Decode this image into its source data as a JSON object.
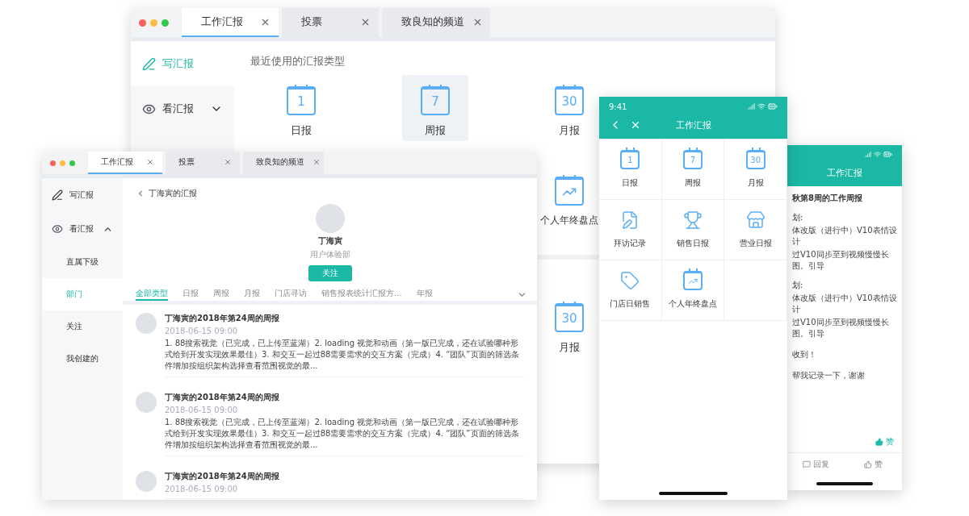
{
  "back_window": {
    "tabs": [
      {
        "label": "工作汇报",
        "selected": true
      },
      {
        "label": "投票",
        "selected": false
      },
      {
        "label": "致良知的频道",
        "selected": false
      }
    ],
    "sidebar": [
      {
        "kind": "write",
        "label": "写汇报",
        "selected": true
      },
      {
        "kind": "view",
        "label": "看汇报",
        "selected": false,
        "expanded": false
      }
    ],
    "heading": "最近使用的汇报类型",
    "recent": [
      {
        "kind": "calendar",
        "number": "1",
        "label": "日报",
        "highlighted": false
      },
      {
        "kind": "calendar",
        "number": "7",
        "label": "周报",
        "highlighted": true
      },
      {
        "kind": "calendar",
        "number": "30",
        "label": "月报",
        "highlighted": false
      }
    ],
    "second_row": [
      {
        "kind": "chart",
        "label": "个人年终盘点"
      }
    ],
    "all_types": [
      {
        "kind": "calendar",
        "number": "30",
        "label": "月报"
      }
    ]
  },
  "front_window": {
    "tabs": [
      {
        "label": "工作汇报",
        "selected": true
      },
      {
        "label": "投票",
        "selected": false
      },
      {
        "label": "致良知的频道",
        "selected": false
      }
    ],
    "sidebar": [
      {
        "kind": "write",
        "label": "写汇报",
        "selected": false
      },
      {
        "kind": "view",
        "label": "看汇报",
        "selected": false,
        "expanded": true,
        "children": [
          {
            "label": "直属下级",
            "selected": false
          },
          {
            "label": "部门",
            "selected": true
          },
          {
            "label": "关注",
            "selected": false
          },
          {
            "label": "我创建的",
            "selected": false
          }
        ]
      }
    ],
    "back_link": "丁海寅的汇报",
    "profile": {
      "name": "丁海寅",
      "department": "用户体验部",
      "follow_button": "关注"
    },
    "filters": [
      {
        "label": "全部类型",
        "selected": true
      },
      {
        "label": "日报",
        "selected": false
      },
      {
        "label": "周报",
        "selected": false
      },
      {
        "label": "月报",
        "selected": false
      },
      {
        "label": "门店寻访",
        "selected": false
      },
      {
        "label": "销售报表统计汇报方...",
        "selected": false
      },
      {
        "label": "年报",
        "selected": false
      }
    ],
    "reports": [
      {
        "title": "丁海寅的2018年第24周的周报",
        "date": "2018-06-15 09:00",
        "summary": "1. 88搜索视觉（已完成，已上传至蓝湖）2. loading 视觉和动画（第一版已完成，还在试验哪种形式给到开发实现效果最佳）3. 和交互一起过88需要需求的交互方案（完成）4. “团队”页面的筛选条件增加按组织架构选择查看范围视觉的最..."
      },
      {
        "title": "丁海寅的2018年第24周的周报",
        "date": "2018-06-15 09:00",
        "summary": "1. 88搜索视觉（已完成，已上传至蓝湖）2. loading 视觉和动画（第一版已完成，还在试验哪种形式给到开发实现效果最佳）3. 和交互一起过88需要需求的交互方案（完成）4. “团队”页面的筛选条件增加按组织架构选择查看范围视觉的最..."
      },
      {
        "title": "丁海寅的2018年第24周的周报",
        "date": "2018-06-15 09:00"
      }
    ]
  },
  "phone_menu": {
    "time": "9:41",
    "title": "工作汇报",
    "items": [
      {
        "kind": "calendar",
        "number": "1",
        "label": "日报"
      },
      {
        "kind": "calendar",
        "number": "7",
        "label": "周报"
      },
      {
        "kind": "calendar",
        "number": "30",
        "label": "月报"
      },
      {
        "kind": "edit",
        "label": "拜访记录"
      },
      {
        "kind": "trophy",
        "label": "销售日报"
      },
      {
        "kind": "store",
        "label": "营业日报"
      },
      {
        "kind": "tag",
        "label": "门店日销售"
      },
      {
        "kind": "chart",
        "label": "个人年终盘点"
      }
    ]
  },
  "phone_detail": {
    "title": "工作汇报",
    "lines": [
      {
        "kind": "heading",
        "text": "秋第8周的工作周报"
      },
      {
        "kind": "label",
        "text": "划:"
      },
      {
        "kind": "body",
        "text": "体改版（进行中）V10表情设计"
      },
      {
        "kind": "body",
        "text": "过V10同步至到视频慢慢长图。引导"
      },
      {
        "kind": "label",
        "text": "划:"
      },
      {
        "kind": "body",
        "text": "体改版（进行中）V10表情设计"
      },
      {
        "kind": "body",
        "text": "过V10同步至到视频慢慢长图。引导"
      },
      {
        "kind": "comment",
        "text": "收到！"
      },
      {
        "kind": "comment",
        "text": "帮我记录一下，谢谢"
      }
    ],
    "like_label": "赞",
    "actions": [
      {
        "kind": "reply",
        "label": "回复"
      },
      {
        "kind": "like",
        "label": "赞"
      }
    ]
  }
}
